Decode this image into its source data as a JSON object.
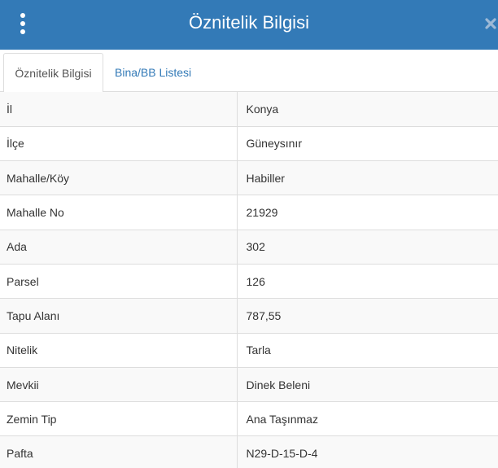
{
  "header": {
    "title": "Öznitelik Bilgisi",
    "menu_icon": "kebab-vertical-icon",
    "close_icon": "close-icon",
    "accent": "#337ab7"
  },
  "tabs": [
    {
      "label": "Öznitelik Bilgisi",
      "active": true
    },
    {
      "label": "Bina/BB Listesi",
      "active": false
    }
  ],
  "attributes": [
    {
      "key": "İl",
      "value": "Konya"
    },
    {
      "key": "İlçe",
      "value": "Güneysınır"
    },
    {
      "key": "Mahalle/Köy",
      "value": "Habiller"
    },
    {
      "key": "Mahalle No",
      "value": "21929"
    },
    {
      "key": "Ada",
      "value": "302"
    },
    {
      "key": "Parsel",
      "value": "126"
    },
    {
      "key": "Tapu Alanı",
      "value": "787,55"
    },
    {
      "key": "Nitelik",
      "value": "Tarla"
    },
    {
      "key": "Mevkii",
      "value": "Dinek Beleni"
    },
    {
      "key": "Zemin Tip",
      "value": "Ana Taşınmaz"
    },
    {
      "key": "Pafta",
      "value": "N29-D-15-D-4"
    }
  ]
}
